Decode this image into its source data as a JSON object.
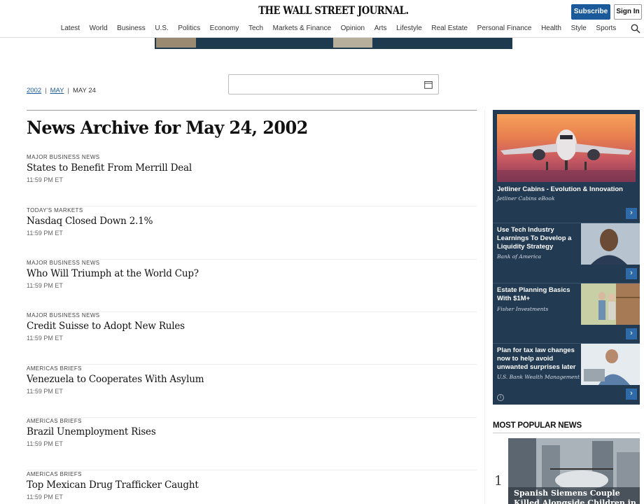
{
  "header": {
    "masthead": "THE WALL STREET JOURNAL.",
    "subscribe_label": "Subscribe",
    "signin_label": "Sign In",
    "nav": [
      "Latest",
      "World",
      "Business",
      "U.S.",
      "Politics",
      "Economy",
      "Tech",
      "Markets & Finance",
      "Opinion",
      "Arts",
      "Lifestyle",
      "Real Estate",
      "Personal Finance",
      "Health",
      "Style",
      "Sports"
    ],
    "search_icon": "search-icon"
  },
  "breadcrumb": {
    "year": "2002",
    "month": "MAY",
    "day": "MAY 24",
    "separator": "|"
  },
  "date_picker": {
    "icon": "calendar-icon"
  },
  "main": {
    "title": "News Archive for May 24, 2002",
    "articles": [
      {
        "category": "MAJOR BUSINESS NEWS",
        "headline": "States to Benefit From Merrill Deal",
        "time": "11:59 PM ET"
      },
      {
        "category": "TODAY'S MARKETS",
        "headline": "Nasdaq Closed Down 2.1%",
        "time": "11:59 PM ET"
      },
      {
        "category": "MAJOR BUSINESS NEWS",
        "headline": "Who Will Triumph at the World Cup?",
        "time": "11:59 PM ET"
      },
      {
        "category": "MAJOR BUSINESS NEWS",
        "headline": "Credit Suisse to Adopt New Rules",
        "time": "11:59 PM ET"
      },
      {
        "category": "AMERICAS BRIEFS",
        "headline": "Venezuela to Cooperates With Asylum",
        "time": "11:59 PM ET"
      },
      {
        "category": "AMERICAS BRIEFS",
        "headline": "Brazil Unemployment Rises",
        "time": "11:59 PM ET"
      },
      {
        "category": "AMERICAS BRIEFS",
        "headline": "Top Mexican Drug Trafficker Caught",
        "time": "11:59 PM ET"
      }
    ]
  },
  "sidebar": {
    "ads": [
      {
        "title": "Jetliner Cabins - Evolution & Innovation",
        "sponsor": "Jetliner Cabins eBook"
      },
      {
        "title": "Use Tech Industry Learnings To Develop a Liquidity Strategy",
        "sponsor": "Bank of America"
      },
      {
        "title": "Estate Planning Basics With $1M+",
        "sponsor": "Fisher Investments"
      },
      {
        "title": "Plan for tax law changes now to help avoid unwanted surprises later",
        "sponsor": "U.S. Bank Wealth Management"
      }
    ],
    "arrow": "›",
    "most_popular_label": "MOST POPULAR NEWS",
    "popular": [
      {
        "rank": "1",
        "headline": "Spanish Siemens Couple Killed Alongside Children in Hudson"
      }
    ]
  }
}
